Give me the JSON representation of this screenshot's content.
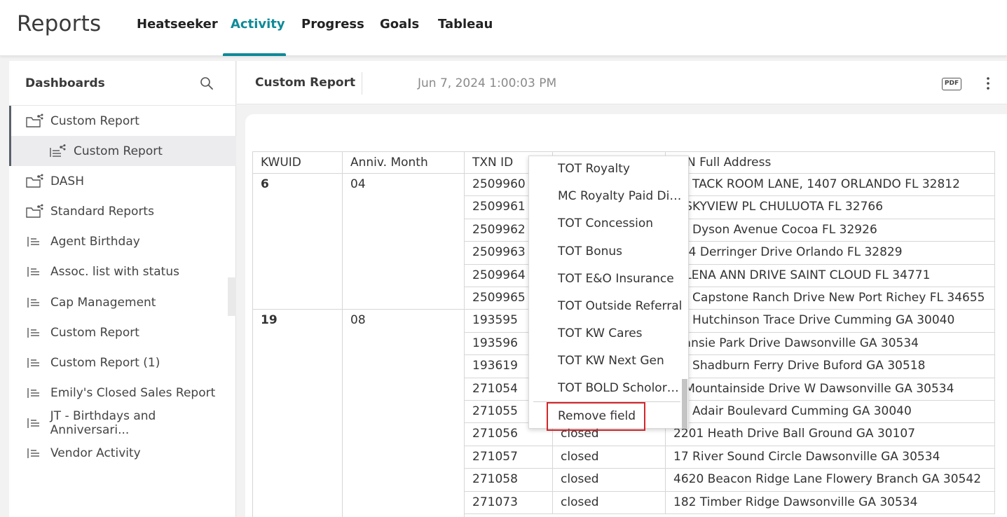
{
  "app": {
    "title": "Reports",
    "nav_tabs": [
      {
        "label": "Heatseeker"
      },
      {
        "label": "Activity"
      },
      {
        "label": "Progress"
      },
      {
        "label": "Goals"
      },
      {
        "label": "Tableau"
      }
    ],
    "active_tab": "Activity",
    "accent_color": "#0f8a99"
  },
  "sidebar": {
    "title": "Dashboards",
    "search_icon": "search-icon",
    "items": [
      {
        "label": "Custom Report",
        "icon": "folder-share-icon"
      },
      {
        "label": "Custom Report",
        "icon": "report-list-icon"
      },
      {
        "label": "DASH",
        "icon": "folder-share-icon"
      },
      {
        "label": "Standard Reports",
        "icon": "folder-share-icon"
      },
      {
        "label": "Agent Birthday",
        "icon": "list-icon"
      },
      {
        "label": "Assoc. list with status",
        "icon": "list-icon"
      },
      {
        "label": "Cap Management",
        "icon": "list-icon"
      },
      {
        "label": "Custom Report",
        "icon": "list-icon"
      },
      {
        "label": "Custom Report (1)",
        "icon": "list-icon"
      },
      {
        "label": "Emily's Closed Sales Report",
        "icon": "list-icon"
      },
      {
        "label": "JT - Birthdays and Anniversari...",
        "icon": "list-icon"
      },
      {
        "label": "Vendor Activity",
        "icon": "list-icon"
      }
    ]
  },
  "report": {
    "title": "Custom Report",
    "timestamp": "Jun 7, 2024 1:00:03 PM",
    "pdf_label": "PDF"
  },
  "table": {
    "headers": [
      "KWUID",
      "Anniv. Month",
      "TXN ID",
      "",
      "TXN Full Address"
    ],
    "visible_header_address": "N Full Address",
    "groups": [
      {
        "kwuid": "6",
        "month": "04"
      },
      {
        "kwuid": "19",
        "month": "08"
      }
    ],
    "rows": [
      {
        "txn": "2509960",
        "status": "",
        "address": "12 TACK ROOM LANE, 1407 ORLANDO FL 32812"
      },
      {
        "txn": "2509961",
        "status": "",
        "address": "3 SKYVIEW PL CHULUOTA FL 32766"
      },
      {
        "txn": "2509962",
        "status": "",
        "address": "29 Dyson Avenue Cocoa FL 32926"
      },
      {
        "txn": "2509963",
        "status": "",
        "address": "934 Derringer Drive Orlando FL 32829"
      },
      {
        "txn": "2509964",
        "status": "",
        "address": "1 LENA ANN DRIVE SAINT CLOUD FL 34771"
      },
      {
        "txn": "2509965",
        "status": "",
        "address": "64 Capstone Ranch Drive New Port Richey FL 34655"
      },
      {
        "txn": "193595",
        "status": "",
        "address": "09 Hutchinson Trace Drive Cumming GA 30040"
      },
      {
        "txn": "193596",
        "status": "",
        "address": "Mansie Park Drive Dawsonville GA 30534"
      },
      {
        "txn": "193619",
        "status": "",
        "address": "42 Shadburn Ferry Drive Buford GA 30518"
      },
      {
        "txn": "271054",
        "status": "",
        "address": "2 Mountainside Drive W Dawsonville GA 30534"
      },
      {
        "txn": "271055",
        "status": "",
        "address": "30 Adair Boulevard Cumming GA 30040"
      },
      {
        "txn": "271056",
        "status": "closed",
        "address": "2201 Heath Drive Ball Ground GA 30107"
      },
      {
        "txn": "271057",
        "status": "closed",
        "address": "17 River Sound Circle Dawsonville GA 30534"
      },
      {
        "txn": "271058",
        "status": "closed",
        "address": "4620 Beacon Ridge Lane Flowery Branch GA 30542"
      },
      {
        "txn": "271073",
        "status": "closed",
        "address": "182 Timber Ridge Dawsonville GA 30534"
      }
    ]
  },
  "context_menu": {
    "items": [
      "TOT Royalty",
      "MC Royalty Paid Dif...",
      "TOT Concession",
      "TOT Bonus",
      "TOT E&O Insurance",
      "TOT Outside Referral",
      "TOT KW Cares",
      "TOT KW Next Gen",
      "TOT BOLD Scholors..."
    ],
    "remove_label": "Remove field",
    "highlight_color": "#d0262b"
  }
}
